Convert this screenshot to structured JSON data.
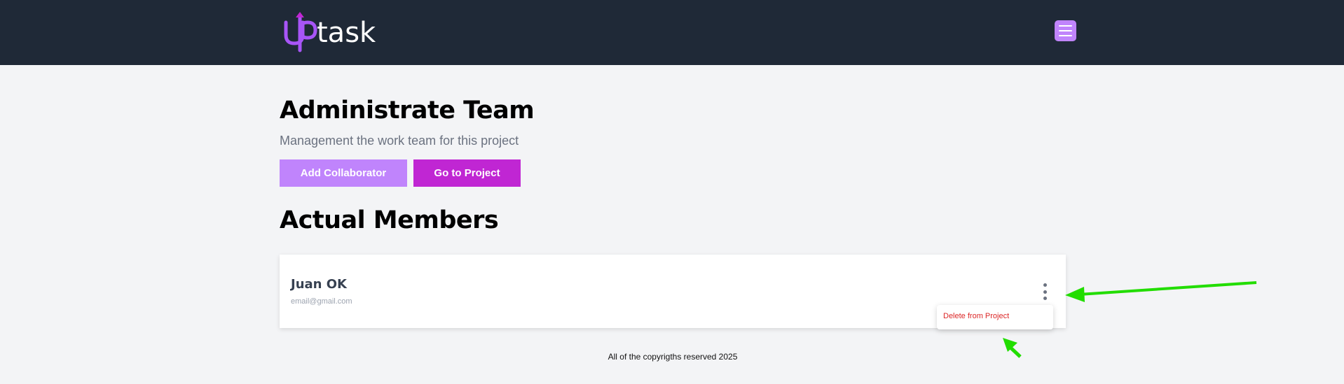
{
  "header": {
    "logo_text": "uptask",
    "menu_icon": "hamburger-icon",
    "background": "#1f2937",
    "logo_accent": "#a855f7"
  },
  "page": {
    "title": "Administrate Team",
    "subtitle": "Management the work team for this project",
    "add_collaborator_label": "Add Collaborator",
    "go_to_project_label": "Go to Project",
    "members_title": "Actual Members"
  },
  "members": [
    {
      "name": "Juan OK",
      "email": "email@gmail.com",
      "menu_icon": "kebab-menu-icon"
    }
  ],
  "member_menu": {
    "delete_label": "Delete from Project"
  },
  "footer": {
    "text": "All of the copyrigths reserved 2025"
  },
  "colors": {
    "add_button": "#c084fc",
    "go_button": "#c026d3",
    "delete_text": "#dc2626",
    "annotation_arrow": "#22dd00"
  }
}
